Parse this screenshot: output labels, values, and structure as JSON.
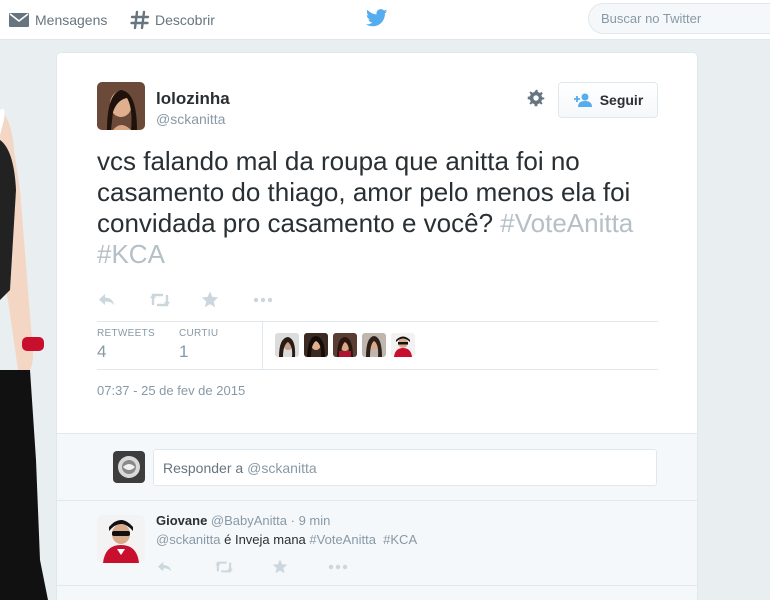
{
  "topbar": {
    "messages_label": "Mensagens",
    "discover_label": "Descobrir",
    "search_placeholder": "Buscar no Twitter"
  },
  "tweet": {
    "author_name": "lolozinha",
    "author_handle": "@sckanitta",
    "follow_label": "Seguir",
    "text_main": "vcs falando mal da roupa que anitta foi no casamento do thiago, amor pelo menos ela foi convidada pro casamento e você?",
    "hashtag_1": "#VoteAnitta",
    "hashtag_2": "#KCA",
    "stats": {
      "retweets_label": "RETWEETS",
      "retweets_value": "4",
      "likes_label": "CURTIU",
      "likes_value": "1"
    },
    "timestamp": "07:37 - 25 de fev de 2015"
  },
  "reply_box": {
    "prefix": "Responder a",
    "mention": "@sckanitta"
  },
  "reply": {
    "name": "Giovane",
    "handle": "@BabyAnitta",
    "separator": "·",
    "time": "9 min",
    "mention": "@sckanitta",
    "text": "é Inveja mana",
    "hashtag_1": "#VoteAnitta",
    "hashtag_2": "#KCA"
  },
  "icons": {
    "messages": "envelope-icon",
    "discover": "hashtag-icon",
    "logo": "twitter-bird-icon",
    "settings": "gear-icon",
    "follow": "add-user-icon",
    "reply": "reply-icon",
    "retweet": "retweet-icon",
    "favorite": "star-icon",
    "more": "more-icon"
  },
  "colors": {
    "brand_blue": "#55acee",
    "muted_text": "#8899a6",
    "hashtag": "#b5bfc6",
    "primary_text": "#292f33"
  }
}
